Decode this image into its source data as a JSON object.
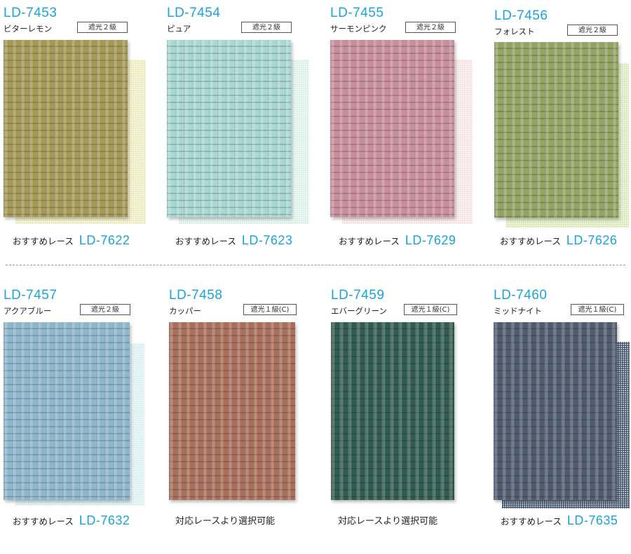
{
  "top": [
    {
      "code": "LD-7453",
      "name": "ビターレモン",
      "grade": "遮光２級",
      "rec_label": "おすすめレース",
      "rec_code": "LD-7622",
      "color": "#a59a55",
      "color_dark": "#84793a",
      "lace": "#ece9b8"
    },
    {
      "code": "LD-7454",
      "name": "ピュア",
      "grade": "遮光２級",
      "rec_label": "おすすめレース",
      "rec_code": "LD-7623",
      "color": "#a9d8d2",
      "color_dark": "#86bdb6",
      "lace": "#d8efe8"
    },
    {
      "code": "LD-7455",
      "name": "サーモンピンク",
      "grade": "遮光２級",
      "rec_label": "おすすめレース",
      "rec_code": "LD-7629",
      "color": "#c98e9d",
      "color_dark": "#ad6f80",
      "lace": "#f5e0e4"
    },
    {
      "code": "LD-7456",
      "name": "フォレスト",
      "grade": "遮光２級",
      "rec_label": "おすすめレース",
      "rec_code": "LD-7626",
      "color": "#93a463",
      "color_dark": "#74864a",
      "lace": "#d7e6b3"
    }
  ],
  "bottom": [
    {
      "code": "LD-7457",
      "name": "アクアブルー",
      "grade": "遮光２級",
      "rec_label": "おすすめレース",
      "rec_code": "LD-7632",
      "color": "#8fb7cc",
      "color_dark": "#6b97ae",
      "lace": "#d6eef0"
    },
    {
      "code": "LD-7458",
      "name": "カッパー",
      "grade": "遮光１級(C)",
      "rec_text": "対応レースより選択可能",
      "color": "#a96f5b",
      "color_dark": "#84513f"
    },
    {
      "code": "LD-7459",
      "name": "エバーグリーン",
      "grade": "遮光１級(C)",
      "rec_text": "対応レースより選択可能",
      "color": "#2f5c4f",
      "color_dark": "#1f4238"
    },
    {
      "code": "LD-7460",
      "name": "ミッドナイト",
      "grade": "遮光１級(C)",
      "rec_label": "おすすめレース",
      "rec_code": "LD-7635",
      "color": "#4f5c70",
      "color_dark": "#353f52",
      "lace": "#344663"
    }
  ]
}
